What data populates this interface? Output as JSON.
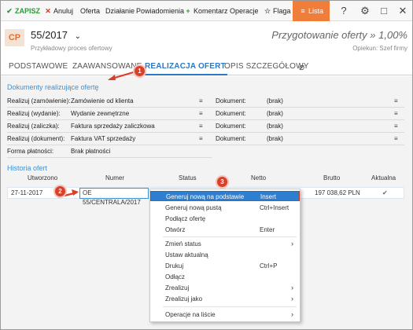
{
  "toolbar": {
    "save": "ZAPISZ",
    "cancel": "Anuluj",
    "offer": "Oferta",
    "action": "Działanie",
    "notifications": "Powiadomienia",
    "comment": "Komentarz",
    "operations": "Operacje",
    "flag": "Flaga",
    "list": "Lista",
    "help_icon": "?",
    "settings_icon": "⚙",
    "maximize_icon": "□",
    "close_icon": "✕"
  },
  "header": {
    "badge": "CP",
    "doc_number": "55/2017",
    "doc_subtitle": "Przykładowy proces ofertowy",
    "status_text": "Przygotowanie oferty » 1,00%",
    "owner_text": "Opiekun: Szef firmy"
  },
  "tabs": [
    {
      "label": "PODSTAWOWE"
    },
    {
      "label": "ZAAWANSOWANE"
    },
    {
      "label": "REALIZACJA OFERT"
    },
    {
      "label": "OPIS SZCZEGÓŁOWY"
    }
  ],
  "documents": {
    "title": "Dokumenty realizujące ofertę",
    "rows": [
      {
        "label": "Realizuj (zamówienie):",
        "value": "Zamówienie od klienta",
        "doc_label": "Dokument:",
        "doc_value": "(brak)"
      },
      {
        "label": "Realizuj (wydanie):",
        "value": "Wydanie zewnętrzne",
        "doc_label": "Dokument:",
        "doc_value": "(brak)"
      },
      {
        "label": "Realizuj (zaliczka):",
        "value": "Faktura sprzedaży zaliczkowa",
        "doc_label": "Dokument:",
        "doc_value": "(brak)"
      },
      {
        "label": "Realizuj (dokument):",
        "value": "Faktura VAT sprzedaży",
        "doc_label": "Dokument:",
        "doc_value": "(brak)"
      }
    ],
    "payment_label": "Forma płatności:",
    "payment_value": "Brak płatności",
    "menu_glyph": "≡"
  },
  "history": {
    "title": "Historia ofert",
    "columns": [
      "Utworzono",
      "Numer",
      "Status",
      "Netto",
      "Brutto",
      "Aktualna"
    ],
    "row": {
      "created": "27-11-2017",
      "number": "OE 55/CENTRALA/2017",
      "status": "",
      "netto": "",
      "brutto": "197 038,62 PLN",
      "current": "✔"
    }
  },
  "context_menu": {
    "items": [
      {
        "label": "Generuj nową na podstawie",
        "shortcut": "Insert"
      },
      {
        "label": "Generuj nową pustą",
        "shortcut": "Ctrl+Insert"
      },
      {
        "label": "Podłącz ofertę",
        "shortcut": ""
      },
      {
        "label": "Otwórz",
        "shortcut": "Enter"
      },
      {
        "label": "Zmień status",
        "shortcut": ""
      },
      {
        "label": "Ustaw aktualną",
        "shortcut": ""
      },
      {
        "label": "Drukuj",
        "shortcut": "Ctrl+P"
      },
      {
        "label": "Odłącz",
        "shortcut": ""
      },
      {
        "label": "Zrealizuj",
        "shortcut": ""
      },
      {
        "label": "Zrealizuj jako",
        "shortcut": ""
      },
      {
        "label": "Operacje na liście",
        "shortcut": ""
      }
    ],
    "submenu_arrow": "›"
  },
  "annotations": {
    "one": "1",
    "two": "2",
    "three": "3"
  },
  "colors": {
    "accent": "#2b78c4",
    "brand": "#f07d3a",
    "highlight": "#2f7fd1",
    "callout": "#d9402a"
  }
}
